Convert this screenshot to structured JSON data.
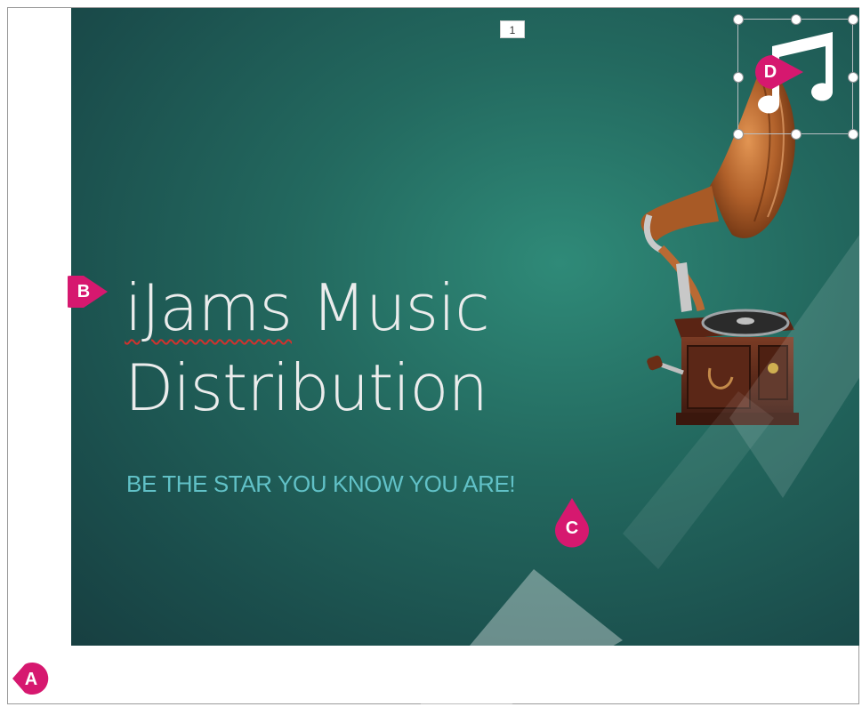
{
  "slide": {
    "page_number": "1",
    "title_word_1": "iJams",
    "title_line_1_rest": " Music",
    "title_line_2": "Distribution",
    "subtitle": "BE THE STAR YOU KNOW YOU ARE!"
  },
  "callouts": {
    "a": "A",
    "b": "B",
    "c": "C",
    "d": "D"
  },
  "icons": {
    "music_note": "music-notes-icon",
    "gramophone": "gramophone-image"
  },
  "colors": {
    "slide_background": "#23695f",
    "title_text": "#ebecec",
    "subtitle_text": "#61c1c7",
    "callout": "#d6186f",
    "spelling_underline": "#d0322d"
  }
}
